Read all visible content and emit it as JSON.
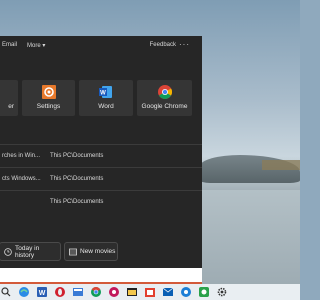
{
  "topbar": {
    "tabs": [
      "Email",
      "More"
    ],
    "feedback": "Feedback",
    "more_glyph": "···"
  },
  "top_apps": [
    {
      "label": "er",
      "icon": "app-icon"
    },
    {
      "label": "Settings",
      "icon": "settings-icon"
    },
    {
      "label": "Word",
      "icon": "word-icon"
    },
    {
      "label": "Google Chrome",
      "icon": "chrome-icon"
    }
  ],
  "recent": [
    {
      "name": "rches in Win...",
      "path": "This PC\\Documents"
    },
    {
      "name": "cts Windows...",
      "path": "This PC\\Documents"
    },
    {
      "name": "",
      "path": "This PC\\Documents"
    }
  ],
  "quick_searches": [
    {
      "label": "Today in history",
      "icon": "clock-icon"
    },
    {
      "label": "New movies",
      "icon": "film-icon"
    }
  ],
  "taskbar": {
    "icons": [
      "search-icon",
      "edge-icon",
      "word-icon",
      "opera-icon",
      "task-view-icon",
      "chrome-icon",
      "settings-icon",
      "file-explorer-icon",
      "store-icon",
      "mail-icon",
      "onedrive-icon",
      "photos-icon",
      "gear-icon",
      "app-icon",
      "app-icon",
      "settings-icon",
      "app-icon"
    ]
  },
  "colors": {
    "accent": "#d35a3a",
    "panel": "#262626",
    "tile": "#353535"
  }
}
